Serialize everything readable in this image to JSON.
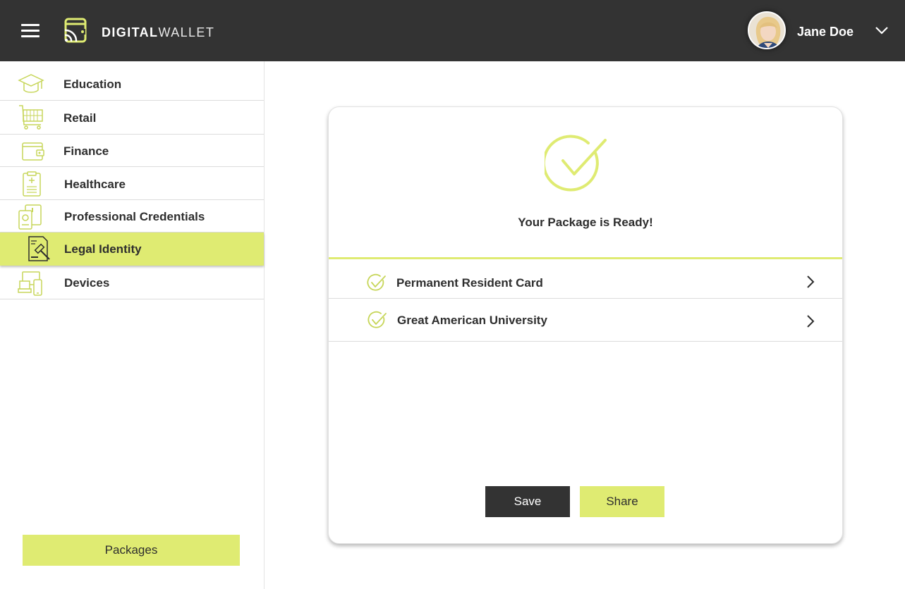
{
  "colors": {
    "accent": "#dfeb72",
    "header_bg": "#333333",
    "text": "#2e2e2e"
  },
  "header": {
    "menu_icon": "hamburger-menu-icon",
    "logo_icon": "wallet-logo-icon",
    "logo_bold": "DIGITAL",
    "logo_light": "WALLET",
    "user_name": "Jane Doe",
    "user_menu_icon": "chevron-down-icon"
  },
  "sidebar": {
    "items": [
      {
        "label": "Education",
        "icon": "graduation-cap-icon",
        "active": false
      },
      {
        "label": "Retail",
        "icon": "shopping-cart-icon",
        "active": false
      },
      {
        "label": "Finance",
        "icon": "wallet-icon",
        "active": false
      },
      {
        "label": "Healthcare",
        "icon": "clipboard-medical-icon",
        "active": false
      },
      {
        "label": "Professional Credentials",
        "icon": "id-badge-icon",
        "active": false
      },
      {
        "label": "Legal Identity",
        "icon": "gavel-document-icon",
        "active": true
      },
      {
        "label": "Devices",
        "icon": "devices-icon",
        "active": false
      }
    ],
    "packages_label": "Packages"
  },
  "main": {
    "status_icon": "check-circle-icon",
    "ready_text": "Your Package is Ready!",
    "items": [
      {
        "title": "Permanent Resident Card",
        "icon": "check-circle-icon",
        "arrow": "chevron-right-icon"
      },
      {
        "title": "Great American University",
        "icon": "check-circle-icon",
        "arrow": "chevron-right-icon"
      }
    ],
    "save_label": "Save",
    "share_label": "Share"
  }
}
